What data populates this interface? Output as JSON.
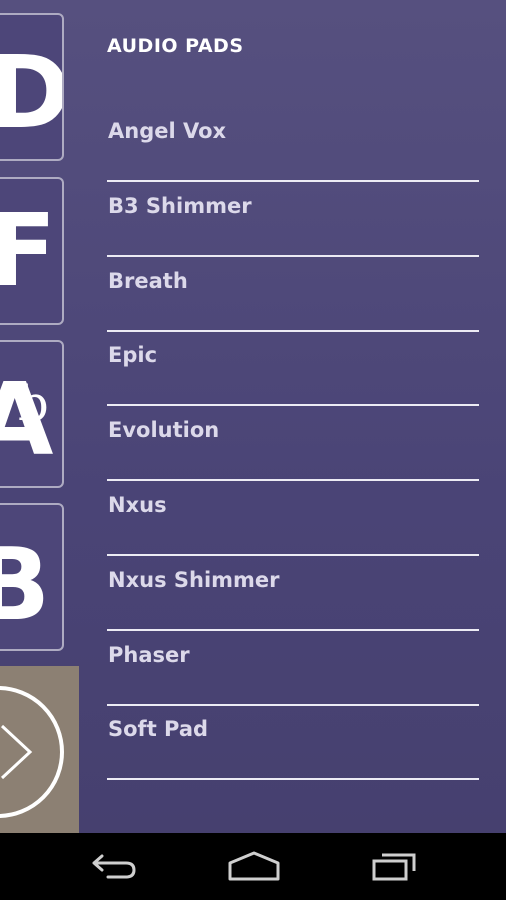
{
  "header": {
    "title": "AUDIO PADS"
  },
  "keys": [
    {
      "note": "D",
      "accidental": ""
    },
    {
      "note": "F",
      "accidental": ""
    },
    {
      "note": "A",
      "accidental": "b"
    },
    {
      "note": "B",
      "accidental": ""
    }
  ],
  "pads": [
    {
      "label": "Angel Vox"
    },
    {
      "label": "B3 Shimmer"
    },
    {
      "label": "Breath"
    },
    {
      "label": "Epic"
    },
    {
      "label": "Evolution"
    },
    {
      "label": "Nxus"
    },
    {
      "label": "Nxus Shimmer"
    },
    {
      "label": "Phaser"
    },
    {
      "label": "Soft Pad"
    }
  ],
  "colors": {
    "background": "#4a4574",
    "divider": "#ecebf4",
    "play_panel": "#8c8073"
  },
  "icons": {
    "play": "play-icon",
    "back": "back-icon",
    "home": "home-icon",
    "recents": "recents-icon"
  }
}
